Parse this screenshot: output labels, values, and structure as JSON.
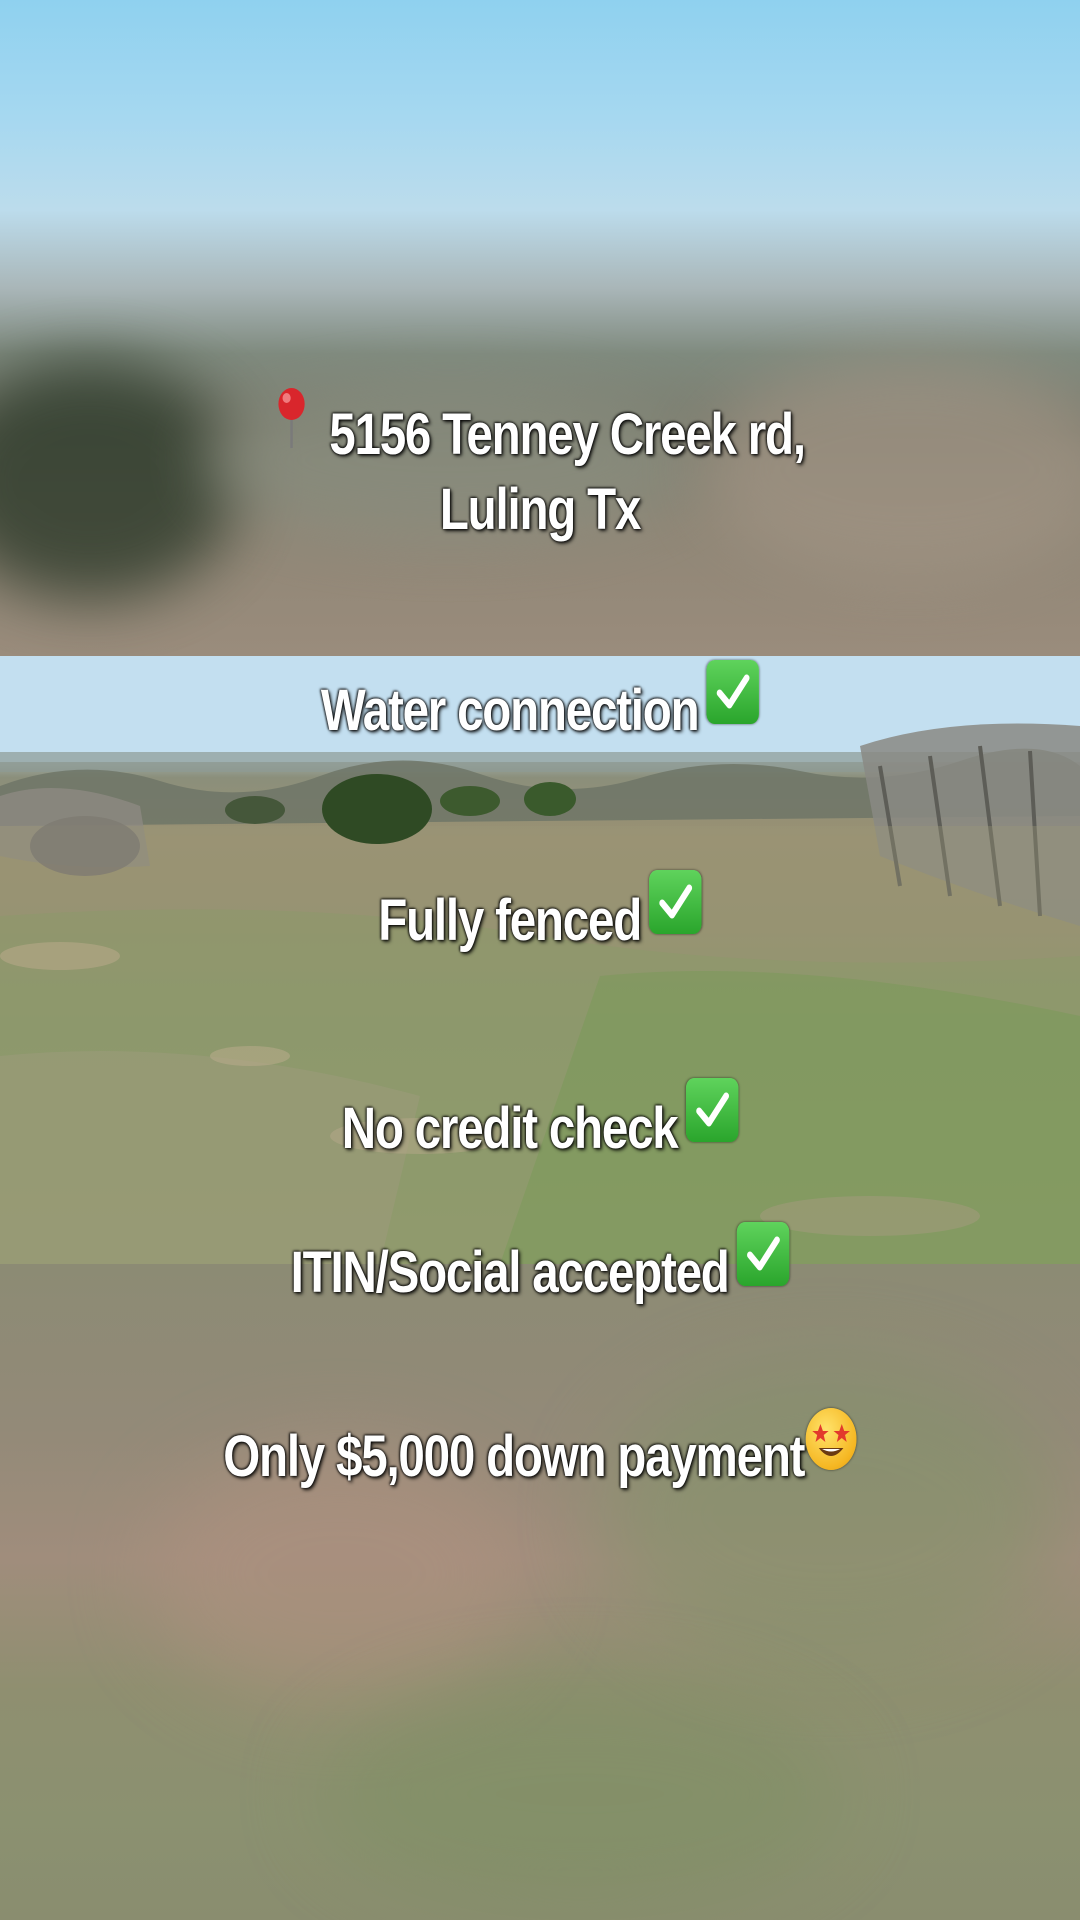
{
  "captions": {
    "address_line1": "5156 Tenney Creek rd,",
    "address_line2": "Luling Tx",
    "water": "Water connection",
    "fenced": "Fully fenced",
    "credit": "No credit check",
    "itin": "ITIN/Social accepted",
    "down_payment": "Only $5,000 down payment"
  },
  "icons": {
    "pin": "round-pushpin-icon",
    "check": "check-mark-button-icon",
    "star_struck": "star-struck-face-icon"
  },
  "colors": {
    "text": "#ffffff",
    "check_green": "#2aa52c",
    "pin_red": "#d9262c",
    "emoji_yellow": "#f5b621"
  }
}
